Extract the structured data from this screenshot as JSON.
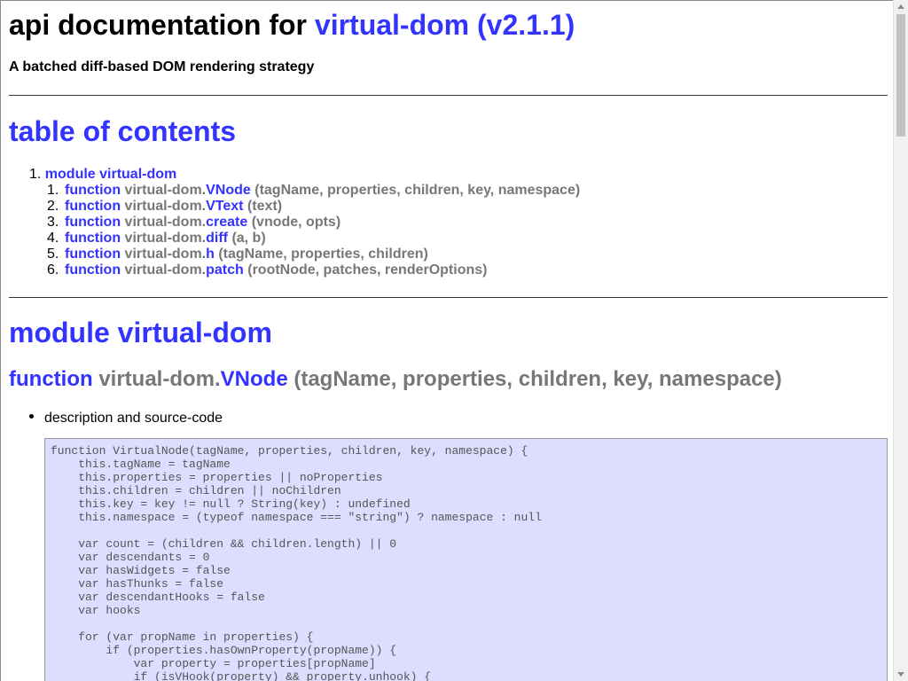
{
  "header": {
    "title_prefix": "api documentation for",
    "title_link": "virtual-dom (v2.1.1)",
    "subtitle": "A batched diff-based DOM rendering strategy"
  },
  "toc": {
    "heading": "table of contents",
    "module_item": {
      "number": "1.",
      "label": "module virtual-dom"
    },
    "items": [
      {
        "number": "1.",
        "keyword": "function",
        "prefix": "virtual-dom.",
        "name": "VNode",
        "args": "(tagName, properties, children, key, namespace)"
      },
      {
        "number": "2.",
        "keyword": "function",
        "prefix": "virtual-dom.",
        "name": "VText",
        "args": "(text)"
      },
      {
        "number": "3.",
        "keyword": "function",
        "prefix": "virtual-dom.",
        "name": "create",
        "args": "(vnode, opts)"
      },
      {
        "number": "4.",
        "keyword": "function",
        "prefix": "virtual-dom.",
        "name": "diff",
        "args": "(a, b)"
      },
      {
        "number": "5.",
        "keyword": "function",
        "prefix": "virtual-dom.",
        "name": "h",
        "args": "(tagName, properties, children)"
      },
      {
        "number": "6.",
        "keyword": "function",
        "prefix": "virtual-dom.",
        "name": "patch",
        "args": "(rootNode, patches, renderOptions)"
      }
    ]
  },
  "module_section": {
    "heading": "module virtual-dom",
    "function_heading": {
      "keyword": "function",
      "prefix": "virtual-dom.",
      "name": "VNode",
      "args": "(tagName, properties, children, key, namespace)"
    },
    "bullet": "description and source-code",
    "code": "function VirtualNode(tagName, properties, children, key, namespace) {\n    this.tagName = tagName\n    this.properties = properties || noProperties\n    this.children = children || noChildren\n    this.key = key != null ? String(key) : undefined\n    this.namespace = (typeof namespace === \"string\") ? namespace : null\n\n    var count = (children && children.length) || 0\n    var descendants = 0\n    var hasWidgets = false\n    var hasThunks = false\n    var descendantHooks = false\n    var hooks\n\n    for (var propName in properties) {\n        if (properties.hasOwnProperty(propName)) {\n            var property = properties[propName]\n            if (isVHook(property) && property.unhook) {"
  },
  "colors": {
    "link": "#3333ff",
    "muted": "#777777",
    "code_bg": "#ddddff"
  }
}
